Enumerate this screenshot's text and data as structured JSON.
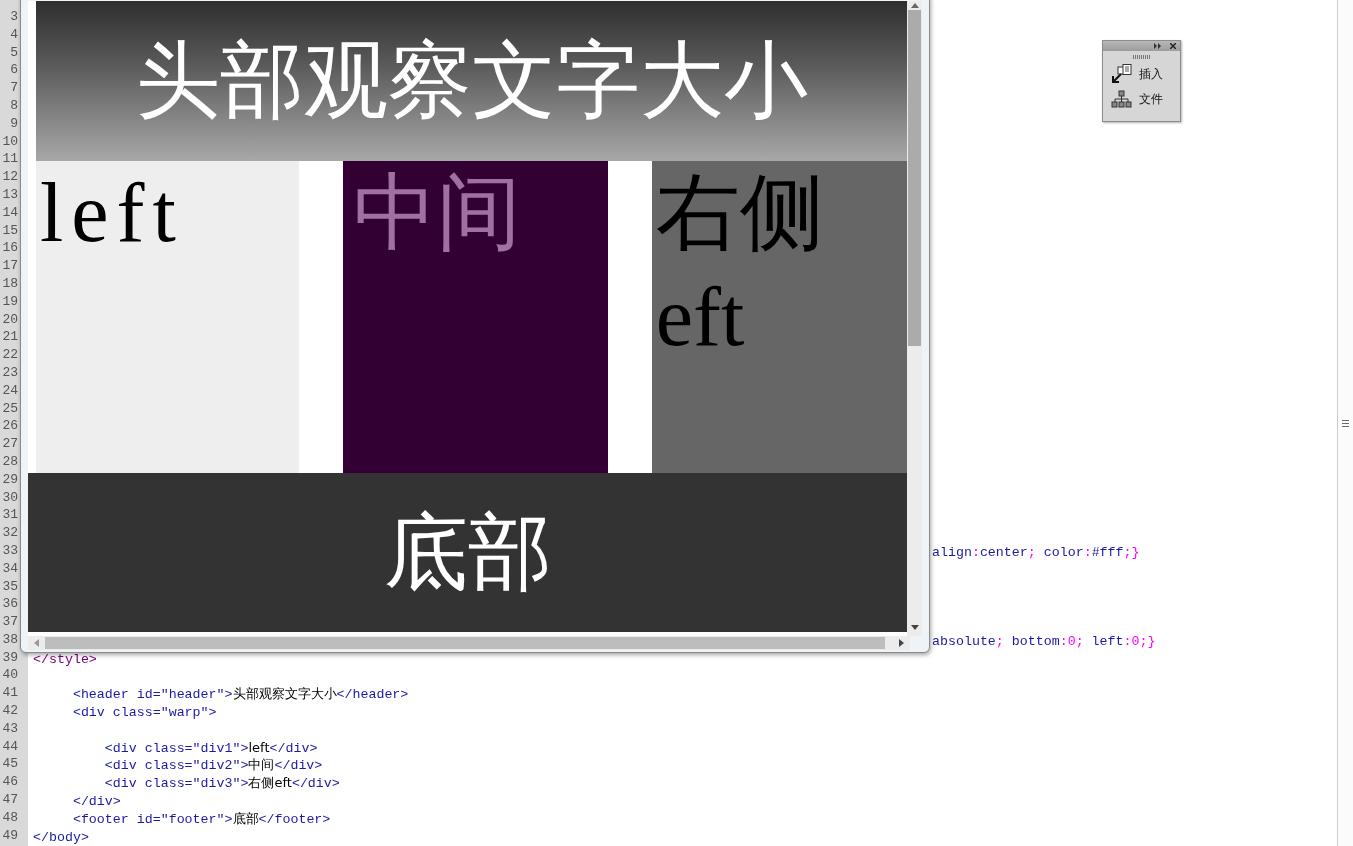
{
  "editor": {
    "lines": [
      {
        "number": "3"
      },
      {
        "number": "4"
      },
      {
        "number": "5"
      },
      {
        "number": "6"
      },
      {
        "number": "7"
      },
      {
        "number": "8"
      },
      {
        "number": "9"
      },
      {
        "number": "10"
      },
      {
        "number": "11"
      },
      {
        "number": "12"
      },
      {
        "number": "13"
      },
      {
        "number": "14"
      },
      {
        "number": "15"
      },
      {
        "number": "16"
      },
      {
        "number": "17"
      },
      {
        "number": "18"
      },
      {
        "number": "19"
      },
      {
        "number": "20"
      },
      {
        "number": "21"
      },
      {
        "number": "22"
      },
      {
        "number": "23"
      },
      {
        "number": "24"
      },
      {
        "number": "25"
      },
      {
        "number": "26"
      },
      {
        "number": "27"
      },
      {
        "number": "28"
      },
      {
        "number": "29"
      },
      {
        "number": "30"
      },
      {
        "number": "31"
      },
      {
        "number": "32"
      },
      {
        "number": "33",
        "kind": "covered",
        "segments": [
          {
            "kind": "code",
            "text": "align"
          },
          {
            "kind": "sym",
            "text": ":"
          },
          {
            "kind": "code",
            "text": "center"
          },
          {
            "kind": "sym",
            "text": ";"
          },
          {
            "kind": "code",
            "text": " color"
          },
          {
            "kind": "sym",
            "text": ":"
          },
          {
            "kind": "code",
            "text": "#fff"
          },
          {
            "kind": "sym",
            "text": ";}"
          }
        ]
      },
      {
        "number": "34"
      },
      {
        "number": "35"
      },
      {
        "number": "36"
      },
      {
        "number": "37"
      },
      {
        "number": "38",
        "kind": "covered",
        "segments": [
          {
            "kind": "code",
            "text": "absolute"
          },
          {
            "kind": "sym",
            "text": ";"
          },
          {
            "kind": "code",
            "text": " bottom"
          },
          {
            "kind": "sym",
            "text": ":0;"
          },
          {
            "kind": "code",
            "text": " left"
          },
          {
            "kind": "sym",
            "text": ":0;}"
          }
        ]
      },
      {
        "number": "39",
        "kind": "plain",
        "segments": [
          {
            "kind": "style",
            "text": "</style>"
          }
        ]
      },
      {
        "number": "40"
      },
      {
        "number": "41",
        "kind": "plain",
        "segments": [
          {
            "kind": "code",
            "text": "     <header id=\"header\">"
          },
          {
            "kind": "text",
            "text": "头部观察文字大小"
          },
          {
            "kind": "code",
            "text": "</header>"
          }
        ]
      },
      {
        "number": "42",
        "kind": "plain",
        "segments": [
          {
            "kind": "code",
            "text": "     <div class=\"warp\">"
          }
        ]
      },
      {
        "number": "43"
      },
      {
        "number": "44",
        "kind": "plain",
        "segments": [
          {
            "kind": "code",
            "text": "         <div class=\"div1\">"
          },
          {
            "kind": "text",
            "text": "left"
          },
          {
            "kind": "code",
            "text": "</div>"
          }
        ]
      },
      {
        "number": "45",
        "kind": "plain",
        "segments": [
          {
            "kind": "code",
            "text": "         <div class=\"div2\">"
          },
          {
            "kind": "text",
            "text": "中间"
          },
          {
            "kind": "code",
            "text": "</div>"
          }
        ]
      },
      {
        "number": "46",
        "kind": "plain",
        "segments": [
          {
            "kind": "code",
            "text": "         <div class=\"div3\">"
          },
          {
            "kind": "text",
            "text": "右侧eft"
          },
          {
            "kind": "code",
            "text": "</div>"
          }
        ]
      },
      {
        "number": "47",
        "kind": "plain",
        "segments": [
          {
            "kind": "code",
            "text": "     </div>"
          }
        ]
      },
      {
        "number": "48",
        "kind": "plain",
        "segments": [
          {
            "kind": "code",
            "text": "     <footer id=\"footer\">"
          },
          {
            "kind": "text",
            "text": "底部"
          },
          {
            "kind": "code",
            "text": "</footer>"
          }
        ]
      },
      {
        "number": "49",
        "kind": "plain",
        "segments": [
          {
            "kind": "code",
            "text": "</body>"
          }
        ]
      }
    ]
  },
  "preview": {
    "header": "头部观察文字大小",
    "columns": [
      {
        "text": "left",
        "color": "#eeeeee"
      },
      {
        "text": "中间",
        "color": "#330033"
      },
      {
        "text": "右侧eft",
        "color": "#666666"
      }
    ],
    "footer": "底部"
  },
  "panel": {
    "items": [
      {
        "kind": "insert",
        "label": "插入"
      },
      {
        "kind": "files",
        "label": "文件"
      }
    ]
  }
}
